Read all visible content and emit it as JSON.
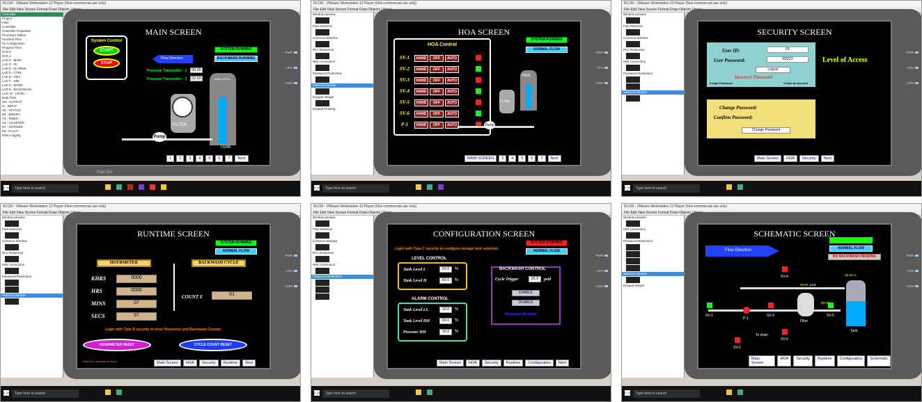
{
  "window": {
    "title": "RLCM - VMware Workstation 12 Player (Non-commercial use only)",
    "menu": "File  Edit  View  Screen  Format  Draw  Objects  Library",
    "player": "Player"
  },
  "taskbar": {
    "search_placeholder": "Type here to search"
  },
  "panel_main": {
    "title": "MAIN SCREEN",
    "system_control": "System Control",
    "start": "START",
    "stop": "STOP",
    "flow_direction": "Flow Direction",
    "status_running": "SYSTEM RUNNING",
    "status_backwash": "BACKWASH RUNNING",
    "pt1_label": "Pressure Transmitter - 1",
    "pt1_value": "00.05",
    "pt2_label": "Pressure Transmitter - 2",
    "pt2_value": "02.50",
    "tank_level": "TANK LEVEL",
    "filter": "FILTER",
    "pump": "Pump",
    "tank": "TANK",
    "nav": [
      "1",
      "2",
      "3",
      "4",
      "5",
      "6",
      "7",
      "Next"
    ],
    "brand": "Fast Sol"
  },
  "panel_hoa": {
    "title": "HOA SCREEN",
    "hoa_control": "HOA Control",
    "status_running": "SYSTEM RUNNING",
    "normal_flow": "NORMAL FLOW",
    "rows": [
      {
        "name": "SV-1"
      },
      {
        "name": "SV-2"
      },
      {
        "name": "SV-3"
      },
      {
        "name": "SV-4"
      },
      {
        "name": "SV-5"
      },
      {
        "name": "SV-6"
      },
      {
        "name": "P-1"
      }
    ],
    "hand": "HAND",
    "off": "OFF",
    "auto": "AUTO",
    "filter": "FILTER",
    "tank": "TANK",
    "pump": "Pump",
    "nav": [
      "MAIN SCREEN",
      "3",
      "4",
      "5",
      "6",
      "7",
      "Next"
    ]
  },
  "panel_security": {
    "title": "SECURITY SCREEN",
    "user_id_label": "User ID:",
    "user_id": "01",
    "user_password_label": "User Password:",
    "user_password": "00022",
    "logout": "Logout",
    "incorrect": "Incorrect Password",
    "forgot": "Forgot Password",
    "create": "Create an Account",
    "level": "Level of Access",
    "change_password": "Change Password:",
    "confirm_password": "Confirm Password:",
    "change_button": "Change Password",
    "nav": [
      "Main Screen",
      "HOA",
      "Security",
      "Next"
    ]
  },
  "panel_runtime": {
    "title": "RUNTIME SCREEN",
    "status_running": "SYSTEM RUNNING",
    "normal_flow": "NORMAL FLOW",
    "hourmeter": "HOURMETER",
    "backwash_cycle": "BACKWASH CYCLE",
    "rows": [
      {
        "label": "KHRS",
        "value": "0000"
      },
      {
        "label": "HRS",
        "value": "0000"
      },
      {
        "label": "MINS",
        "value": "07"
      },
      {
        "label": "SECS",
        "value": "57"
      }
    ],
    "count_label": "COUNT #",
    "count_value": "01",
    "login_note": "Login with Type B security to reset Hourmeter and Backwash Counter",
    "hour_reset": "HOURMETER RESET",
    "cycle_reset": "CYCLE COUNT RESET",
    "hold_note": "Hold for 1 seconds to Reset",
    "nav": [
      "Main Screen",
      "HOA",
      "Security",
      "Runtime",
      "Next"
    ]
  },
  "panel_config": {
    "title": "CONFIGURATION SCREEN",
    "system_stopped": "SYSTEM STOPPED",
    "normal_flow": "NORMAL FLOW",
    "login_note": "Login with Type C security to configure storage tank setpoints",
    "level_control": "LEVEL CONTROL",
    "tank_l_label": "Tank Level  L",
    "tank_l": "20.0",
    "tank_h_label": "Tank Level  H",
    "tank_h": "80.0",
    "pct": "%",
    "backwash_control": "BACKWASH CONTROL",
    "cycle_trigger_label": "Cycle Trigger",
    "cycle_trigger": "05.0",
    "psid": "psid",
    "enable": "ENABLE",
    "disable": "DISABLE",
    "backwash_enabled": "Backwash Enabled",
    "alarm_control": "ALARM CONTROL",
    "tank_ll_label": "Tank Level  LL",
    "tank_ll": "10.0",
    "tank_hh_label": "Tank Level  HH",
    "tank_hh": "90.0",
    "pressure_hh_label": "Pressure  HH",
    "pressure_hh": "15.0",
    "nav": [
      "Main Screen",
      "HOA",
      "Security",
      "Runtime",
      "Configuration",
      "Next"
    ]
  },
  "panel_schematic": {
    "title": "SCHEMATIC SCREEN",
    "flow_direction": "Flow Direction",
    "normal_flow": "NORMAL FLOW",
    "no_backwash": "NO BACKWASH PENDING",
    "sv1": "SV-1",
    "sv2": "SV-2",
    "sv3": "SV-3",
    "sv4": "SV-4",
    "sv5": "SV-5",
    "sv6": "SV-6",
    "p1": "P-1",
    "filter": "Filter",
    "tank": "Tank",
    "to_drain": "To drain",
    "pressure1": "00.00",
    "pressure2": "00.00",
    "psid": "psid",
    "tank_pct": "45.40 %",
    "nav": [
      "Main Screen",
      "HOA",
      "Security",
      "Runtime",
      "Configuration",
      "Schematic"
    ]
  }
}
